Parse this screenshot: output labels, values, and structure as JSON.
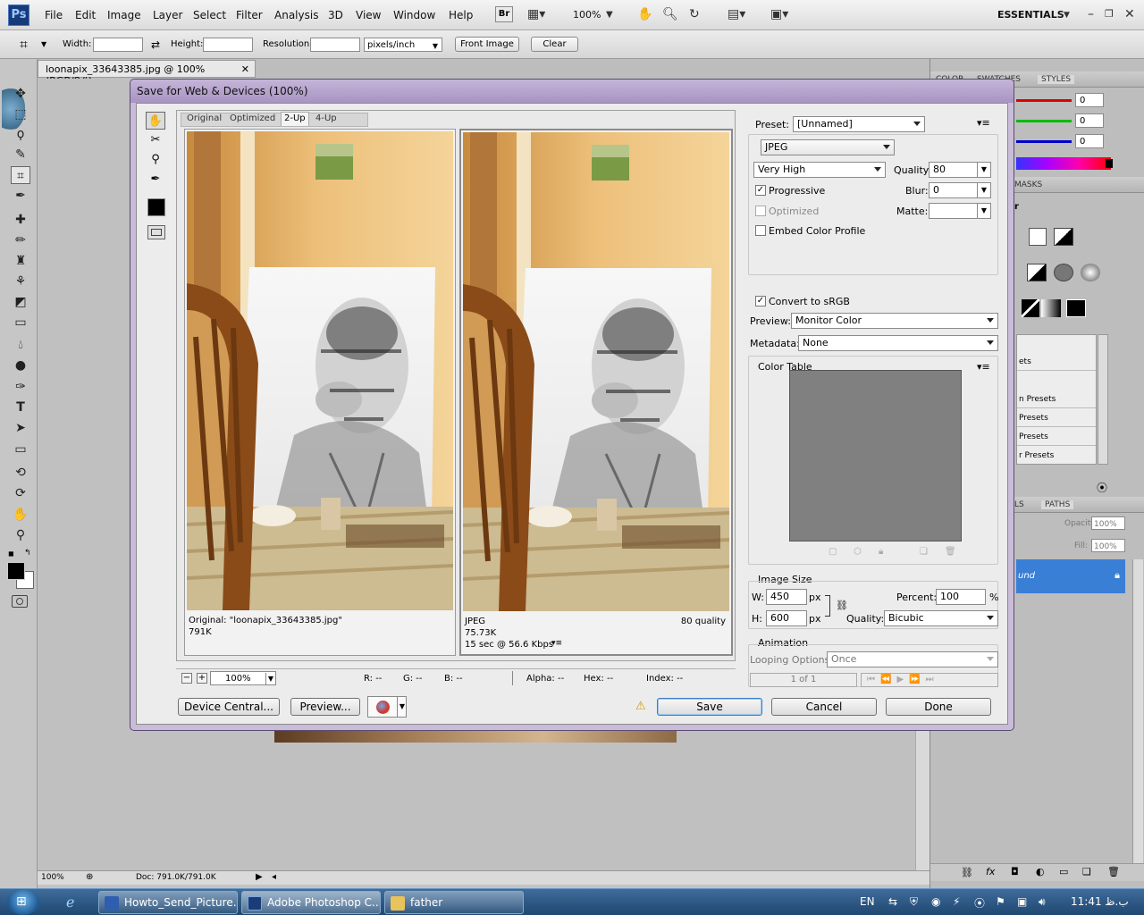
{
  "menubar": {
    "logo": "Ps",
    "items": [
      "File",
      "Edit",
      "Image",
      "Layer",
      "Select",
      "Filter",
      "Analysis",
      "3D",
      "View",
      "Window",
      "Help"
    ],
    "bridge_label": "Br",
    "zoom": "100%",
    "workspace": "ESSENTIALS"
  },
  "options_bar": {
    "width_label": "Width:",
    "height_label": "Height:",
    "resolution_label": "Resolution:",
    "unit": "pixels/inch",
    "front_image": "Front Image",
    "clear": "Clear"
  },
  "document": {
    "tab_title": "loonapix_33643385.jpg @ 100% (RGB/8#)",
    "close": "✕",
    "status_zoom": "100%",
    "status_doc": "Doc: 791.0K/791.0K"
  },
  "right_panels": {
    "tabs_top": [
      "COLOR",
      "SWATCHES",
      "STYLES"
    ],
    "color_values": [
      "0",
      "0",
      "0"
    ],
    "masks_tab": "MASKS",
    "presets": [
      "ets",
      "n Presets",
      "Presets",
      "Presets",
      "r Presets"
    ],
    "paths_tabs": [
      "LS",
      "PATHS"
    ],
    "opacity_label": "Opacity:",
    "opacity_value": "100%",
    "fill_label": "Fill:",
    "fill_value": "100%",
    "layer_name": "und"
  },
  "dialog": {
    "title": "Save for Web & Devices (100%)",
    "view_tabs": [
      "Original",
      "Optimized",
      "2-Up",
      "4-Up"
    ],
    "active_tab": "2-Up",
    "left_pane": {
      "line1": "Original: \"loonapix_33643385.jpg\"",
      "line2": "791K"
    },
    "right_pane": {
      "format": "JPEG",
      "size": "75.73K",
      "time": "15 sec @ 56.6 Kbps",
      "quality_note": "80 quality"
    },
    "zoom_value": "100%",
    "readout": {
      "r": "R: --",
      "g": "G: --",
      "b": "B: --",
      "alpha": "Alpha: --",
      "hex": "Hex: --",
      "index": "Index: --"
    },
    "settings": {
      "preset_label": "Preset:",
      "preset_value": "[Unnamed]",
      "format_value": "JPEG",
      "compression_value": "Very High",
      "quality_label": "Quality:",
      "quality_value": "80",
      "progressive_label": "Progressive",
      "blur_label": "Blur:",
      "blur_value": "0",
      "optimized_label": "Optimized",
      "matte_label": "Matte:",
      "embed_label": "Embed Color Profile",
      "convert_label": "Convert to sRGB",
      "preview_label": "Preview:",
      "preview_value": "Monitor Color",
      "metadata_label": "Metadata:",
      "metadata_value": "None",
      "color_table_label": "Color Table",
      "image_size_label": "Image Size",
      "w_label": "W:",
      "w_value": "450",
      "h_label": "H:",
      "h_value": "600",
      "px": "px",
      "percent_label": "Percent:",
      "percent_value": "100",
      "percent_sign": "%",
      "quality2_label": "Quality:",
      "resample_value": "Bicubic",
      "animation_label": "Animation",
      "looping_label": "Looping Options:",
      "looping_value": "Once",
      "frame_counter": "1 of 1"
    },
    "buttons": {
      "device_central": "Device Central...",
      "preview": "Preview...",
      "save": "Save",
      "cancel": "Cancel",
      "done": "Done"
    }
  },
  "taskbar": {
    "tasks": [
      "Howto_Send_Picture...",
      "Adobe Photoshop C...",
      "father"
    ],
    "lang": "EN",
    "time": "11:41 ب.ظ"
  },
  "colors": {
    "dialog_title": "#b09fc8",
    "selected_layer": "#3a7fd6",
    "taskbar": "#2a5480"
  }
}
